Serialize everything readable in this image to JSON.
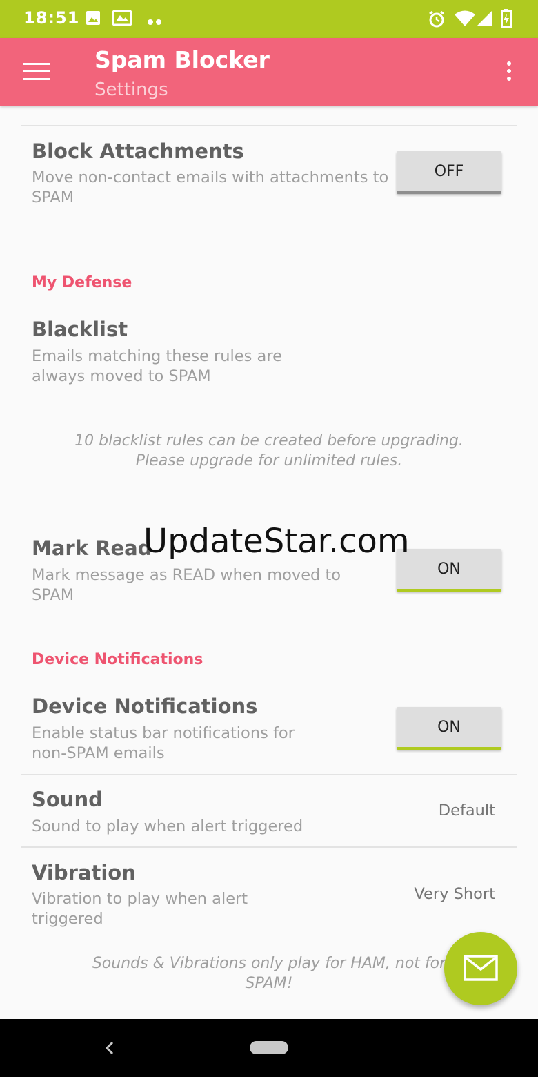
{
  "status_bar": {
    "time": "18:51",
    "icons": [
      "image-icon",
      "gallery-icon",
      "more-dots-icon",
      "alarm-icon",
      "wifi-icon",
      "signal-icon",
      "battery-icon"
    ],
    "color": "#afca20"
  },
  "app_bar": {
    "title": "Spam Blocker",
    "subtitle": "Settings",
    "color": "#f2647b"
  },
  "settings": {
    "block_attachments": {
      "title": "Block Attachments",
      "subtitle": "Move non-contact emails with attachments to SPAM",
      "toggle": "OFF"
    },
    "section_my_defense": "My Defense",
    "blacklist": {
      "title": "Blacklist",
      "subtitle": "Emails matching these rules are always moved to SPAM"
    },
    "blacklist_note": "10 blacklist rules can be created before upgrading. Please upgrade for unlimited rules.",
    "mark_read": {
      "title": "Mark Read",
      "subtitle": "Mark message as READ when moved to SPAM",
      "toggle": "ON"
    },
    "section_device_notifications": "Device Notifications",
    "device_notifications": {
      "title": "Device Notifications",
      "subtitle": "Enable status bar notifications for non-SPAM emails",
      "toggle": "ON"
    },
    "sound": {
      "title": "Sound",
      "subtitle": "Sound to play when alert triggered",
      "value": "Default"
    },
    "vibration": {
      "title": "Vibration",
      "subtitle": "Vibration to play when alert triggered",
      "value": "Very Short"
    },
    "footer_note": "Sounds & Vibrations only play for HAM, not for SPAM!"
  },
  "watermark": "UpdateStar.com",
  "fab": {
    "icon": "mail-icon",
    "color": "#afca20"
  }
}
